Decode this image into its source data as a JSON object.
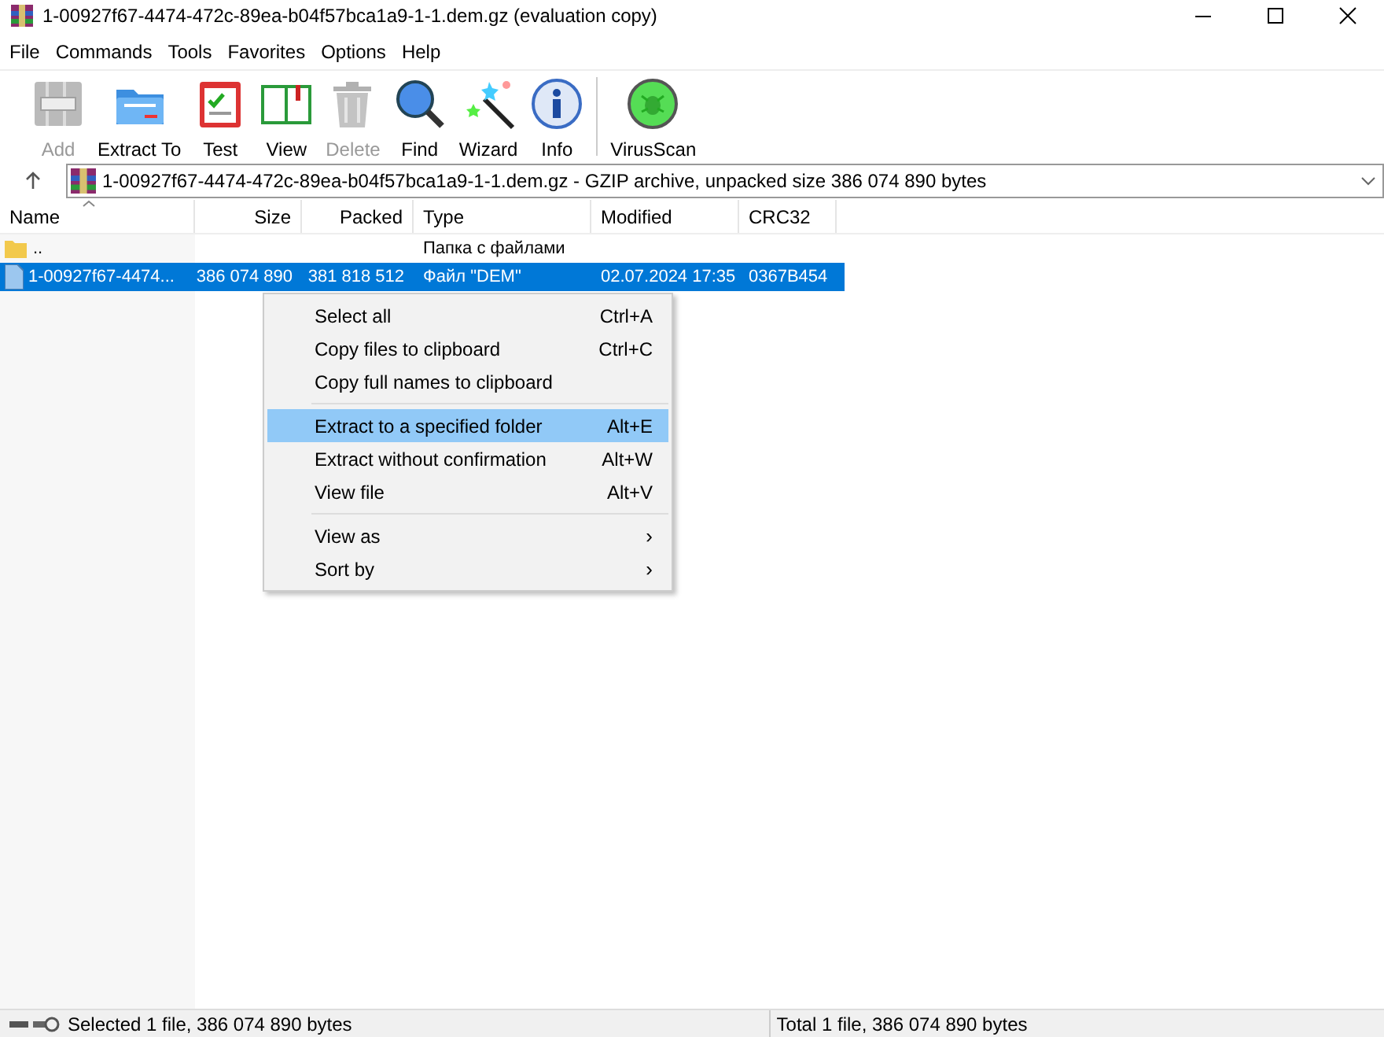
{
  "window": {
    "title": "1-00927f67-4474-472c-89ea-b04f57bca1a9-1-1.dem.gz (evaluation copy)"
  },
  "menu_bar": [
    "File",
    "Commands",
    "Tools",
    "Favorites",
    "Options",
    "Help"
  ],
  "toolbar": [
    {
      "label": "Add",
      "kind": "add",
      "disabled": true
    },
    {
      "label": "Extract To",
      "kind": "extract",
      "disabled": false
    },
    {
      "label": "Test",
      "kind": "test",
      "disabled": false
    },
    {
      "label": "View",
      "kind": "view",
      "disabled": false
    },
    {
      "label": "Delete",
      "kind": "delete",
      "disabled": true
    },
    {
      "label": "Find",
      "kind": "find",
      "disabled": false
    },
    {
      "label": "Wizard",
      "kind": "wizard",
      "disabled": false
    },
    {
      "label": "Info",
      "kind": "info",
      "disabled": false
    },
    {
      "label": "VirusScan",
      "kind": "virus",
      "disabled": false
    }
  ],
  "address": "1-00927f67-4474-472c-89ea-b04f57bca1a9-1-1.dem.gz - GZIP archive, unpacked size 386 074 890 bytes",
  "table": {
    "columns": [
      "Name",
      "Size",
      "Packed",
      "Type",
      "Modified",
      "CRC32"
    ],
    "rows": [
      {
        "kind": "folder",
        "selected": false,
        "cells": [
          "..",
          "",
          "",
          "Папка с файлами",
          "",
          ""
        ]
      },
      {
        "kind": "file",
        "selected": true,
        "cells": [
          "1-00927f67-4474...",
          "386 074 890",
          "381 818 512",
          "Файл \"DEM\"",
          "02.07.2024 17:35",
          "0367B454"
        ]
      }
    ]
  },
  "context_menu": [
    {
      "kind": "item",
      "label": "Select all",
      "shortcut": "Ctrl+A",
      "selected": false
    },
    {
      "kind": "item",
      "label": "Copy files to clipboard",
      "shortcut": "Ctrl+C",
      "selected": false
    },
    {
      "kind": "item",
      "label": "Copy full names to clipboard",
      "selected": false
    },
    {
      "kind": "separator"
    },
    {
      "kind": "item",
      "label": "Extract to a specified folder",
      "shortcut": "Alt+E",
      "selected": true
    },
    {
      "kind": "item",
      "label": "Extract without confirmation",
      "shortcut": "Alt+W",
      "selected": false
    },
    {
      "kind": "item",
      "label": "View file",
      "shortcut": "Alt+V",
      "selected": false
    },
    {
      "kind": "separator"
    },
    {
      "kind": "submenu",
      "label": "View as",
      "arrow": "›",
      "selected": false
    },
    {
      "kind": "submenu",
      "label": "Sort by",
      "arrow": "›",
      "selected": false
    }
  ],
  "status_bar": {
    "left": "Selected 1 file, 386 074 890 bytes",
    "right": "Total 1 file, 386 074 890 bytes"
  }
}
